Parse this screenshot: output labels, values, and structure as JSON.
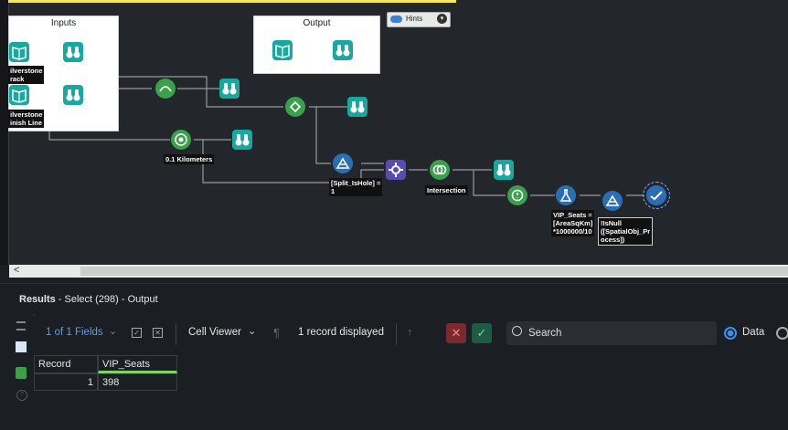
{
  "canvas": {
    "hints": {
      "label": "Hints"
    },
    "containers": {
      "inputs": {
        "title": "Inputs"
      },
      "output": {
        "title": "Output"
      }
    },
    "tool_labels": {
      "silverstone_track": "ilverstone\nrack",
      "silverstone_finish": "ilverstone\ninish Line",
      "buffer": "0.1 Kilometers",
      "filter": "[Split_IsHole] =\n1",
      "intersection": "Intersection",
      "formula": "VIP_Seats =\n[AreaSqKm]\n*1000000/10",
      "filter2": "!IsNull\n([SpatialObj_Pr\nocess])"
    },
    "colors": {
      "teal": "#17a9a0",
      "green": "#3aa14b",
      "blue": "#2a6fb5",
      "purple": "#5a4bb0",
      "connector": "#9a9a9a"
    }
  },
  "scrollbar": {
    "left_arrow": "<"
  },
  "results": {
    "title_bold": "Results",
    "title_rest": " - Select (298) - Output"
  },
  "toolbar": {
    "fields": "1 of 1 Fields",
    "cell_viewer": "Cell Viewer",
    "record_count": "1 record displayed",
    "search_placeholder": "Search",
    "data_option": "Data"
  },
  "table": {
    "columns": [
      "Record",
      "VIP_Seats"
    ],
    "rows": [
      [
        "1",
        "398"
      ]
    ]
  }
}
